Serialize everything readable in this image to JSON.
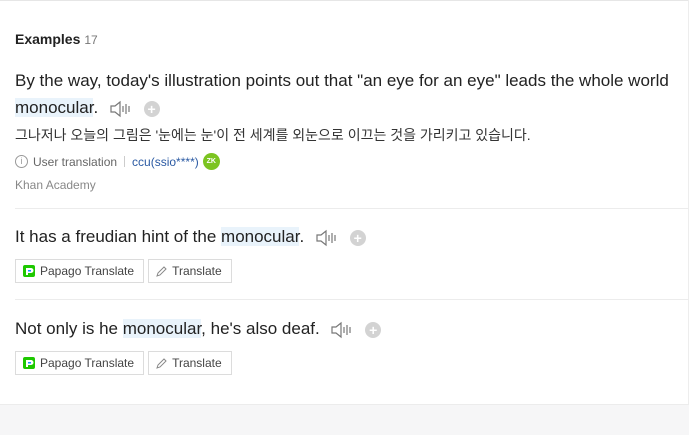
{
  "section": {
    "title": "Examples",
    "count": "17"
  },
  "examples": [
    {
      "pre": "By the way, today's illustration points out that \"an eye for an eye\" leads the whole world ",
      "keyword": "monocular",
      "post": ".",
      "translation": "그나저나 오늘의 그림은 '눈에는 눈'이 전 세계를 외눈으로 이끄는 것을 가리키고 있습니다.",
      "translation_type": "User translation",
      "user": "ccu(ssio****)",
      "avatar_text": "ZK",
      "source": "Khan Academy"
    },
    {
      "pre": "It has a freudian hint of the ",
      "keyword": "monocular",
      "post": ".",
      "papago_label": "Papago Translate",
      "translate_label": "Translate"
    },
    {
      "pre": "Not only is he ",
      "keyword": "monocular",
      "post": ", he's also deaf.",
      "papago_label": "Papago Translate",
      "translate_label": "Translate"
    }
  ],
  "colors": {
    "highlight": "#e9f3fb",
    "avatar": "#7cc421",
    "link": "#2b5aa3"
  },
  "icons": {
    "speaker": "speaker-icon",
    "add": "plus-icon",
    "info": "info-icon",
    "papago": "papago-icon",
    "pencil": "pencil-icon"
  }
}
